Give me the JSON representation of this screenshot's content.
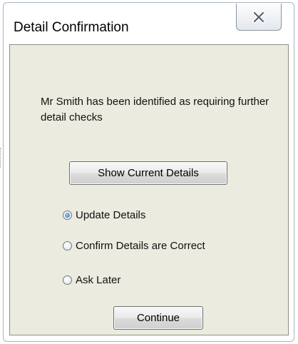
{
  "window": {
    "title": "Detail Confirmation"
  },
  "dialog": {
    "message": "Mr Smith has been identified as requiring further detail checks",
    "show_details_label": "Show Current Details",
    "options": [
      {
        "label": "Update Details",
        "selected": true
      },
      {
        "label": "Confirm Details are Correct",
        "selected": false
      },
      {
        "label": "Ask Later",
        "selected": false
      }
    ],
    "continue_label": "Continue"
  },
  "icons": {
    "close": "close-x-icon",
    "radio": "radio-button-icon"
  },
  "colors": {
    "client_background": "#ecebdf",
    "radio_selected": "#2a6fbf"
  }
}
